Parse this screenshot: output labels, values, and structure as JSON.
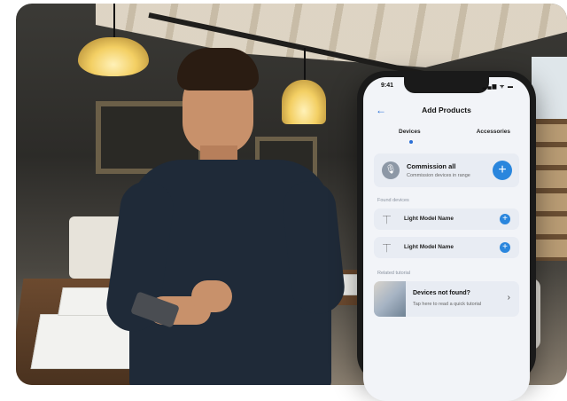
{
  "status": {
    "time": "9:41",
    "icons": "▂▄▆ ᯤ ▬"
  },
  "header": {
    "back_icon": "←",
    "title": "Add Products"
  },
  "tabs": [
    {
      "label": "Devices",
      "selected": true
    },
    {
      "label": "Accessories",
      "selected": false
    }
  ],
  "commission": {
    "title": "Commission all",
    "subtitle": "Commission devices in range",
    "mic_icon": "🎙",
    "add_icon": "+"
  },
  "found_section": "Found devices",
  "devices": [
    {
      "name": "Light Model Name",
      "icon": "lamp-icon",
      "add_icon": "+"
    },
    {
      "name": "Light Model Name",
      "icon": "lamp-icon",
      "add_icon": "+"
    }
  ],
  "tutorial_section": "Related tutorial",
  "tutorial": {
    "title": "Devices not found?",
    "subtitle": "Tap here to read a quick tutorial",
    "chevron": "›"
  },
  "colors": {
    "accent": "#2a86dd",
    "card": "#e8ecf3",
    "screen_bg": "#f2f4f8"
  }
}
